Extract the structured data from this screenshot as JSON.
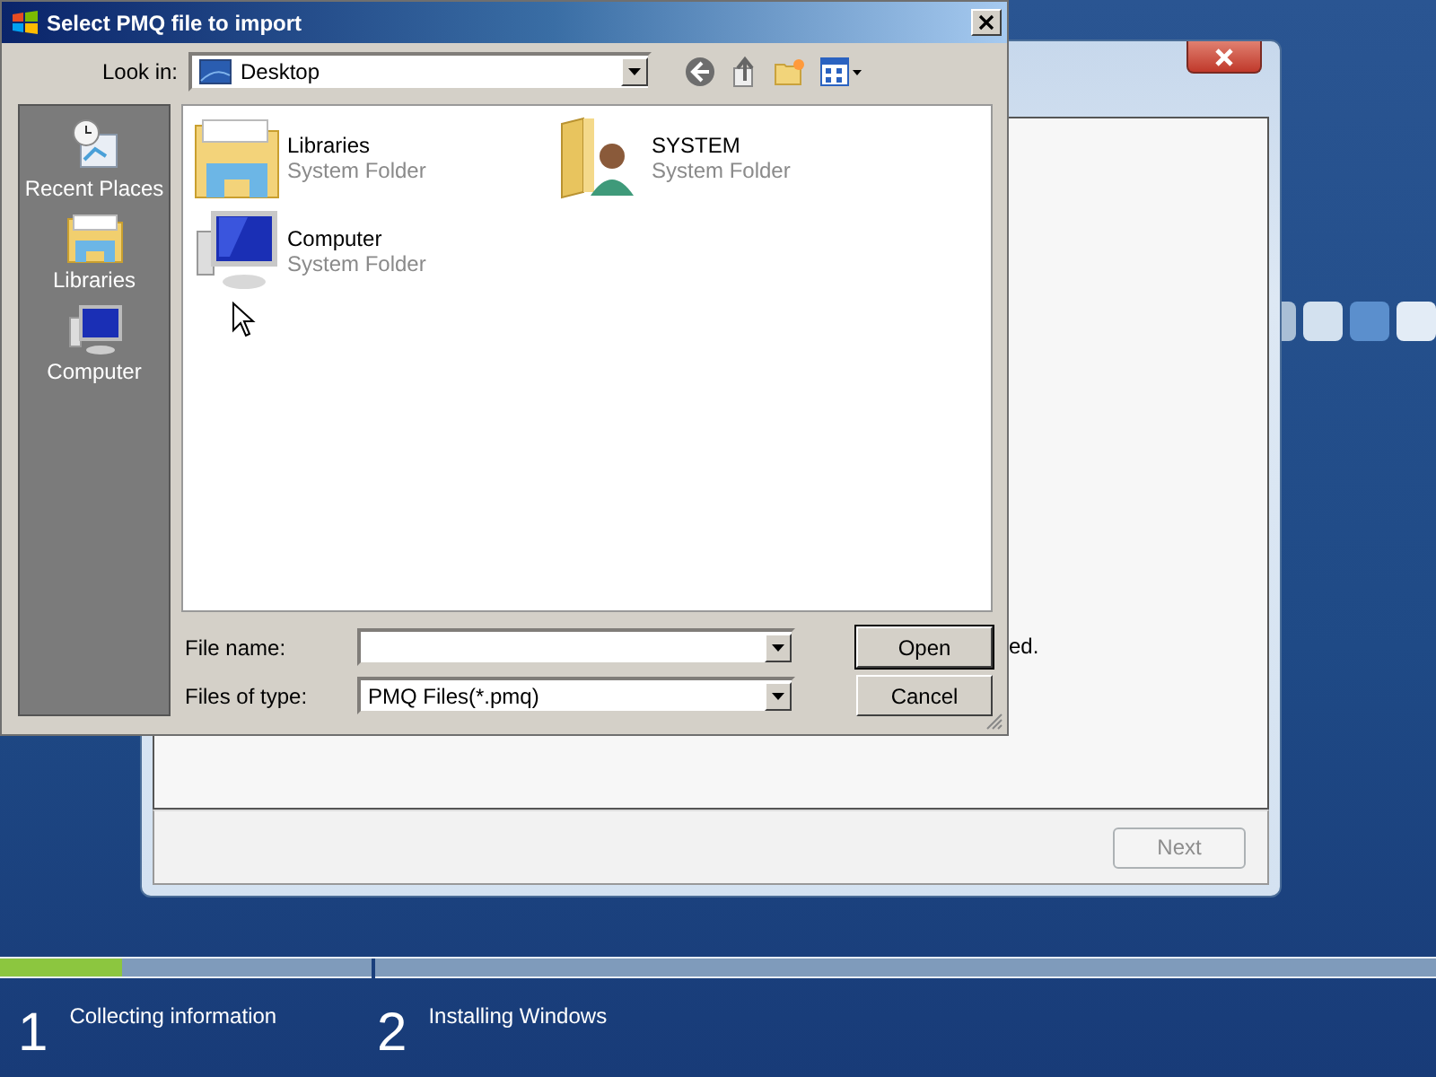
{
  "setup_window": {
    "partial_text": "ed.",
    "next_button": {
      "label": "Next",
      "disabled": true
    }
  },
  "dialog": {
    "title": "Select PMQ file to import",
    "look_in": {
      "label": "Look in:",
      "value": "Desktop"
    },
    "places": [
      {
        "label": "Recent Places",
        "kind": "recent"
      },
      {
        "label": "Libraries",
        "kind": "libraries"
      },
      {
        "label": "Computer",
        "kind": "computer"
      }
    ],
    "files": [
      {
        "name": "Libraries",
        "type": "System Folder",
        "kind": "libraries"
      },
      {
        "name": "SYSTEM",
        "type": "System Folder",
        "kind": "user"
      },
      {
        "name": "Computer",
        "type": "System Folder",
        "kind": "computer"
      }
    ],
    "file_name": {
      "label": "File name:"
    },
    "file_type": {
      "label": "Files of type:",
      "value": "PMQ Files(*.pmq)"
    },
    "buttons": [
      {
        "label": "Open",
        "default": true
      },
      {
        "label": "Cancel",
        "default": false
      }
    ]
  },
  "progress": [
    {
      "number": "1",
      "label": "Collecting information",
      "level": 0.33
    },
    {
      "number": "2",
      "label": "Installing Windows"
    }
  ]
}
